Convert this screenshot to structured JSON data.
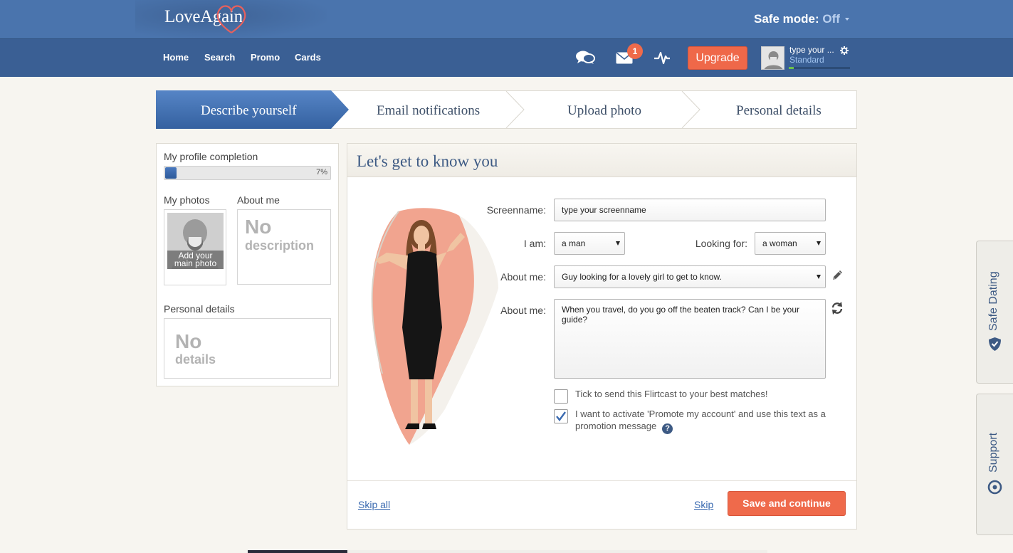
{
  "header": {
    "logo_text": "LoveAgain",
    "safe_mode_label": "Safe mode:",
    "safe_mode_value": "Off"
  },
  "nav": {
    "links": [
      "Home",
      "Search",
      "Promo",
      "Cards"
    ],
    "messages_badge": "1",
    "upgrade_label": "Upgrade",
    "user": {
      "name": "type your ...",
      "plan": "Standard"
    },
    "icons": [
      "chat-icon",
      "envelope-icon",
      "activity-icon",
      "gear-icon"
    ]
  },
  "steps": [
    {
      "label": "Describe yourself",
      "active": true
    },
    {
      "label": "Email notifications",
      "active": false
    },
    {
      "label": "Upload photo",
      "active": false
    },
    {
      "label": "Personal details",
      "active": false
    }
  ],
  "sidebar": {
    "completion_label": "My profile completion",
    "completion_value": "7%",
    "completion_fraction": 0.07,
    "photos_label": "My photos",
    "add_photo_caption_line1": "Add your",
    "add_photo_caption_line2": "main photo",
    "about_label": "About me",
    "about_empty_big": "No",
    "about_empty_small": "description",
    "personal_label": "Personal details",
    "personal_empty_big": "No",
    "personal_empty_small": "details"
  },
  "form": {
    "title": "Let's get to know you",
    "screenname_label": "Screenname:",
    "screenname_value": "type your screenname",
    "i_am_label": "I am:",
    "i_am_value": "a man",
    "looking_for_label": "Looking for:",
    "looking_for_value": "a woman",
    "about_select_label": "About me:",
    "about_select_value": "Guy looking for a lovely girl to get to know.",
    "about_text_label": "About me:",
    "about_text_value": "When you travel, do you go off the beaten track? Can I be your guide?",
    "checkbox1_label": "Tick to send this Flirtcast to your best matches!",
    "checkbox1_checked": false,
    "checkbox2_label": "I want to activate 'Promote my account' and use this text as a promotion message",
    "checkbox2_checked": true,
    "help_symbol": "?"
  },
  "footer": {
    "skip_all": "Skip all",
    "skip": "Skip",
    "save": "Save and continue"
  },
  "side_tabs": {
    "safe_dating": "Safe Dating",
    "support": "Support"
  },
  "colors": {
    "header_blue": "#4a74ad",
    "nav_blue": "#3a5f94",
    "accent_orange": "#ef6a4b",
    "title_blue": "#3d5a84"
  }
}
